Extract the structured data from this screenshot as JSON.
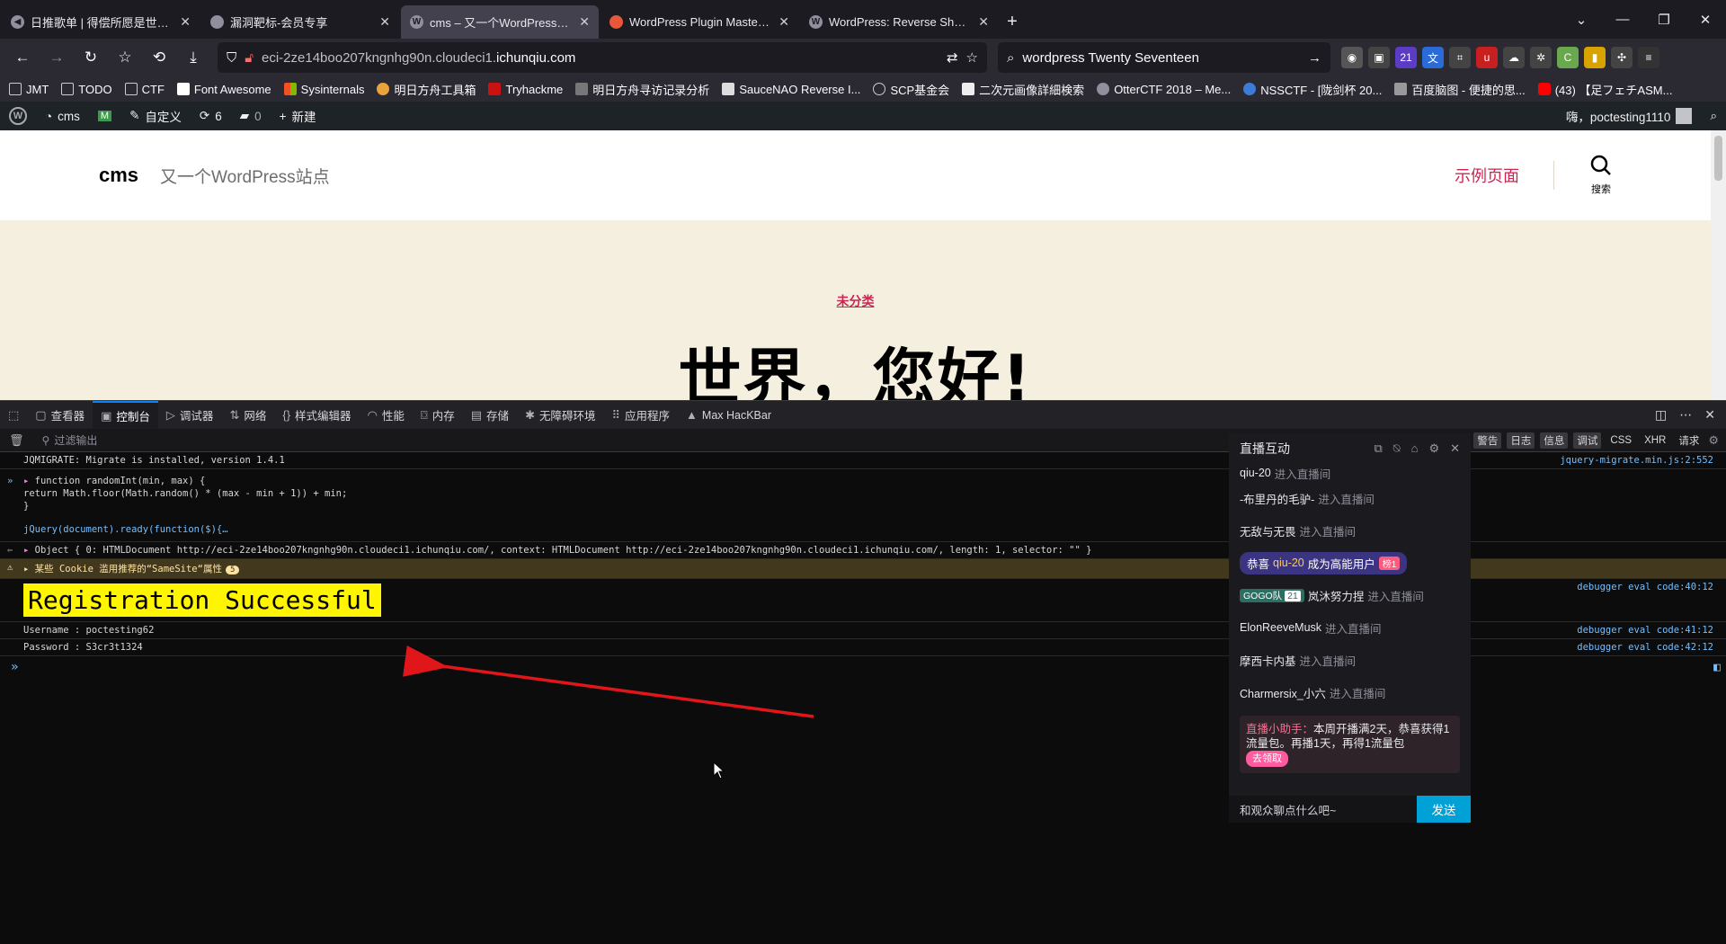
{
  "tabs": [
    {
      "title": "日推歌单 | 得偿所愿是世界上最",
      "active": false
    },
    {
      "title": "漏洞靶标-会员专享",
      "active": false
    },
    {
      "title": "cms – 又一个WordPress站点",
      "active": true
    },
    {
      "title": "WordPress Plugin MasterStu",
      "active": false
    },
    {
      "title": "WordPress: Reverse Shell - H",
      "active": false
    }
  ],
  "address": {
    "url_prefix": "eci-2ze14boo207kngnhg90n.cloudeci1.",
    "url_domain": "ichunqiu.com"
  },
  "search": {
    "query": "wordpress Twenty Seventeen"
  },
  "ext_badge": "21",
  "bookmarks": [
    "JMT",
    "TODO",
    "CTF",
    "Font Awesome",
    "Sysinternals",
    "明日方舟工具箱",
    "Tryhackme",
    "明日方舟寻访记录分析",
    "SauceNAO Reverse I...",
    "SCP基金会",
    "二次元画像詳細検索",
    "OtterCTF 2018 – Me...",
    "NSSCTF - [陇剑杯 20...",
    "百度脑图 - 便捷的思...",
    "(43) 【足フェチASM..."
  ],
  "wpbar": {
    "site": "cms",
    "customize": "自定义",
    "updates": "6",
    "comments": "0",
    "new": "新建",
    "greeting": "嗨，poctesting1110"
  },
  "site": {
    "title": "cms",
    "description": "又一个WordPress站点",
    "nav_link": "示例页面",
    "search_label": "搜索",
    "category": "未分类",
    "post_title": "世界，您好!"
  },
  "devtools": {
    "tabs": [
      "查看器",
      "控制台",
      "调试器",
      "网络",
      "样式编辑器",
      "性能",
      "内存",
      "存储",
      "无障碍环境",
      "应用程序",
      "Max HacKBar"
    ],
    "filter_placeholder": "过滤输出",
    "levels": [
      "警告",
      "日志",
      "信息",
      "调试",
      "CSS",
      "XHR",
      "请求"
    ]
  },
  "console": {
    "jqmigrate": "JQMIGRATE: Migrate is installed, version 1.4.1",
    "jqmigrate_src": "jquery-migrate.min.js:2:552",
    "code_line1": "function randomInt(min, max) {",
    "code_line2": "  return Math.floor(Math.random() * (max - min + 1)) + min;",
    "code_line3": "}",
    "code_line4": "jQuery(document).ready(function($){…",
    "object_line": "Object { 0: HTMLDocument http://eci-2ze14boo207kngnhg90n.cloudeci1.ichunqiu.com/, context: HTMLDocument http://eci-2ze14boo207kngnhg90n.cloudeci1.ichunqiu.com/, length: 1, selector: \"\" }",
    "warning": "某些 Cookie 滥用推荐的“SameSite“属性",
    "warning_count": "5",
    "success": "Registration Successful",
    "username": "Username : poctesting62",
    "password": "Password : S3cr3t1324",
    "src1": "debugger eval code:40:12",
    "src2": "debugger eval code:41:12",
    "src3": "debugger eval code:42:12"
  },
  "live": {
    "title": "直播互动",
    "enter_text": "进入直播间",
    "messages": [
      {
        "user": "qiu-20"
      },
      {
        "user": "-布里丹的毛驴-"
      },
      {
        "user": "无敌与无畏"
      }
    ],
    "congrats": {
      "prefix": "恭喜",
      "user": "qiu-20",
      "suffix": "成为高能用户",
      "badge": "榜1"
    },
    "group_msg": {
      "group": "GOGO队",
      "level": "21",
      "user": "岚沐努力捏"
    },
    "messages2": [
      {
        "user": "ElonReeveMusk"
      },
      {
        "user": "摩西卡内基"
      },
      {
        "user": "Charmersix_小六"
      }
    ],
    "notice": {
      "who": "直播小助手：",
      "text": "本周开播满2天，恭喜获得1流量包。再播1天，再得1流量包",
      "button": "去领取"
    },
    "input_placeholder": "和观众聊点什么吧~",
    "send": "发送"
  },
  "colors": {
    "wp_accent": "#cd2653",
    "highlight": "#fff500",
    "arrow": "#e0161b",
    "devtools_accent": "#0a84ff"
  }
}
